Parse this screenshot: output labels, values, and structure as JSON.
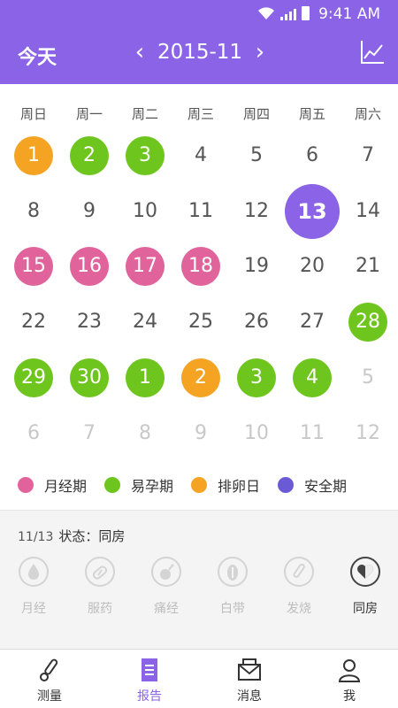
{
  "status_bar": {
    "time": "9:41 AM"
  },
  "header": {
    "today_label": "今天",
    "month": "2015-11",
    "prev_label": "‹",
    "next_label": "›",
    "chart_icon": "trend-chart-icon"
  },
  "weekdays": [
    "周日",
    "周一",
    "周二",
    "周三",
    "周四",
    "周五",
    "周六"
  ],
  "calendar": {
    "rows": [
      [
        {
          "d": "1",
          "s": "orange"
        },
        {
          "d": "2",
          "s": "green"
        },
        {
          "d": "3",
          "s": "green"
        },
        {
          "d": "4",
          "s": ""
        },
        {
          "d": "5",
          "s": ""
        },
        {
          "d": "6",
          "s": ""
        },
        {
          "d": "7",
          "s": ""
        }
      ],
      [
        {
          "d": "8",
          "s": ""
        },
        {
          "d": "9",
          "s": ""
        },
        {
          "d": "10",
          "s": ""
        },
        {
          "d": "11",
          "s": ""
        },
        {
          "d": "12",
          "s": ""
        },
        {
          "d": "13",
          "s": "today"
        },
        {
          "d": "14",
          "s": ""
        }
      ],
      [
        {
          "d": "15",
          "s": "red"
        },
        {
          "d": "16",
          "s": "red"
        },
        {
          "d": "17",
          "s": "red"
        },
        {
          "d": "18",
          "s": "red"
        },
        {
          "d": "19",
          "s": ""
        },
        {
          "d": "20",
          "s": ""
        },
        {
          "d": "21",
          "s": ""
        }
      ],
      [
        {
          "d": "22",
          "s": ""
        },
        {
          "d": "23",
          "s": ""
        },
        {
          "d": "24",
          "s": ""
        },
        {
          "d": "25",
          "s": ""
        },
        {
          "d": "26",
          "s": ""
        },
        {
          "d": "27",
          "s": ""
        },
        {
          "d": "28",
          "s": "green"
        }
      ],
      [
        {
          "d": "29",
          "s": "green"
        },
        {
          "d": "30",
          "s": "green"
        },
        {
          "d": "1",
          "s": "green"
        },
        {
          "d": "2",
          "s": "orange"
        },
        {
          "d": "3",
          "s": "green"
        },
        {
          "d": "4",
          "s": "green"
        },
        {
          "d": "5",
          "s": "fade"
        }
      ],
      [
        {
          "d": "6",
          "s": "fade"
        },
        {
          "d": "7",
          "s": "fade"
        },
        {
          "d": "8",
          "s": "fade"
        },
        {
          "d": "9",
          "s": "fade"
        },
        {
          "d": "10",
          "s": "fade"
        },
        {
          "d": "11",
          "s": "fade"
        },
        {
          "d": "12",
          "s": "fade"
        }
      ]
    ]
  },
  "legend": [
    {
      "label": "月经期",
      "color": "#e0639b"
    },
    {
      "label": "易孕期",
      "color": "#6ec51d"
    },
    {
      "label": "排卵日",
      "color": "#f4a322"
    },
    {
      "label": "安全期",
      "color": "#6a5ad6"
    }
  ],
  "status_panel": {
    "date": "11/13",
    "title": "状态：同房",
    "symptoms": [
      {
        "label": "月经",
        "icon": "drop-icon",
        "active": false
      },
      {
        "label": "服药",
        "icon": "pill-icon",
        "active": false
      },
      {
        "label": "痛经",
        "icon": "bomb-icon",
        "active": false
      },
      {
        "label": "白带",
        "icon": "discharge-icon",
        "active": false
      },
      {
        "label": "发烧",
        "icon": "thermometer-icon",
        "active": false
      },
      {
        "label": "同房",
        "icon": "heart-icon",
        "active": true
      }
    ]
  },
  "tabs": [
    {
      "label": "测量",
      "icon": "thermometer-icon",
      "active": false
    },
    {
      "label": "报告",
      "icon": "report-icon",
      "active": true
    },
    {
      "label": "消息",
      "icon": "mail-icon",
      "active": false
    },
    {
      "label": "我",
      "icon": "user-icon",
      "active": false
    }
  ],
  "colors": {
    "accent": "#8a63e6",
    "red": "#e0639b",
    "green": "#6ec51d",
    "orange": "#f4a322",
    "safe": "#6a5ad6"
  }
}
